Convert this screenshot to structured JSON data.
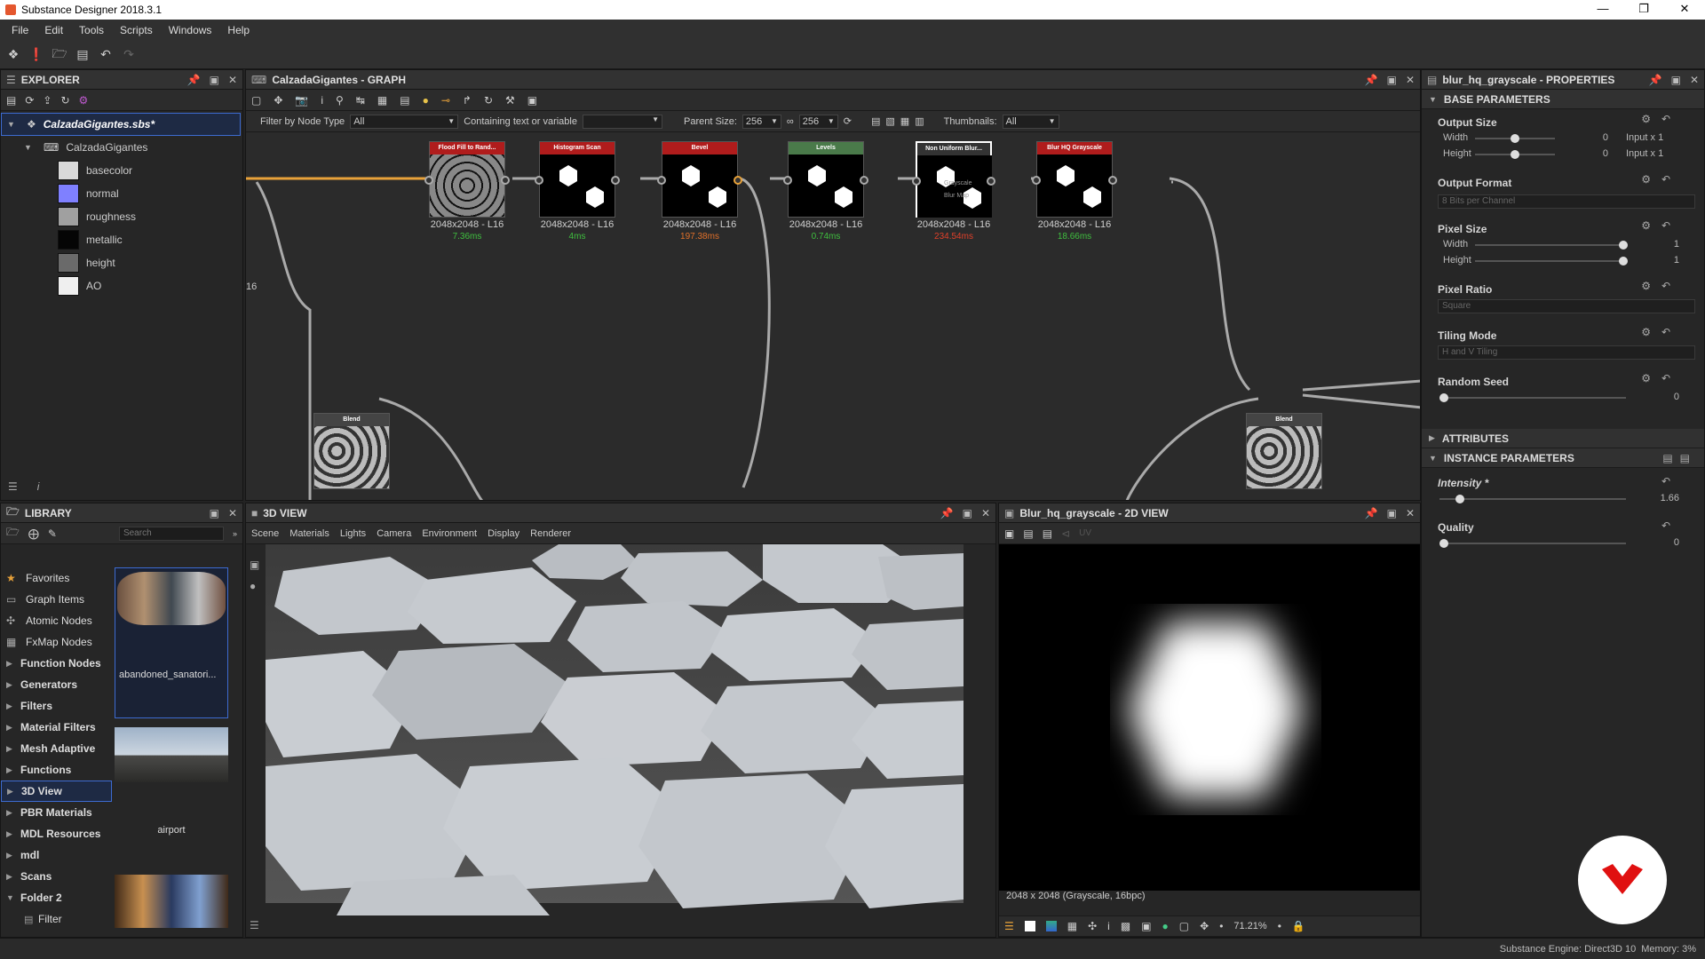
{
  "window": {
    "title": "Substance Designer 2018.3.1"
  },
  "menu": [
    "File",
    "Edit",
    "Tools",
    "Scripts",
    "Windows",
    "Help"
  ],
  "explorer": {
    "title": "EXPLORER",
    "package": "CalzadaGigantes.sbs*",
    "graph": "CalzadaGigantes",
    "outputs": [
      {
        "label": "basecolor",
        "color": "#d9d9d9"
      },
      {
        "label": "normal",
        "color": "#7f80ff"
      },
      {
        "label": "roughness",
        "color": "#a0a0a0"
      },
      {
        "label": "metallic",
        "color": "#050505"
      },
      {
        "label": "height",
        "color": "#6a6a6a"
      },
      {
        "label": "AO",
        "color": "#efefef"
      }
    ]
  },
  "graph": {
    "title": "CalzadaGigantes - GRAPH",
    "filter_label": "Filter by Node Type",
    "filter_value": "All",
    "containing_label": "Containing text or variable",
    "parent_size_label": "Parent Size:",
    "parent_size_1": "256",
    "parent_size_2": "256",
    "thumbnails_label": "Thumbnails:",
    "thumbnails_value": "All",
    "left_edge_label": "16",
    "nodes": [
      {
        "title": "Flood Fill to Rand...",
        "color": "#b01c1c",
        "label": "2048x2048 - L16",
        "time": "7.36ms",
        "time_color": "#3fbf3f"
      },
      {
        "title": "Histogram Scan",
        "color": "#b01c1c",
        "label": "2048x2048 - L16",
        "time": "4ms",
        "time_color": "#3fbf3f"
      },
      {
        "title": "Bevel",
        "color": "#b01c1c",
        "label": "2048x2048 - L16",
        "time": "197.38ms",
        "time_color": "#e0702a"
      },
      {
        "title": "Levels",
        "color": "#4a7a4a",
        "label": "2048x2048 - L16",
        "time": "0.74ms",
        "time_color": "#3fbf3f"
      },
      {
        "title": "Non Uniform Blur...",
        "color": "#333333",
        "label": "2048x2048 - L16",
        "time": "234.54ms",
        "time_color": "#e0402a"
      },
      {
        "title": "Blur HQ Grayscale",
        "color": "#b01c1c",
        "label": "2048x2048 - L16",
        "time": "18.66ms",
        "time_color": "#3fbf3f"
      }
    ],
    "blend_left_title": "Blend",
    "blend_right_title": "Blend",
    "port_text_1": "Grayscale",
    "port_text_2": "Blur Map"
  },
  "library": {
    "title": "LIBRARY",
    "search_placeholder": "Search",
    "categories": [
      {
        "label": "Favorites",
        "icon": "star-icon",
        "bold": false
      },
      {
        "label": "Graph Items",
        "icon": "graph-icon",
        "bold": false
      },
      {
        "label": "Atomic Nodes",
        "icon": "atom-icon",
        "bold": false
      },
      {
        "label": "FxMap Nodes",
        "icon": "grid-icon",
        "bold": false
      },
      {
        "label": "Function Nodes",
        "bold": true
      },
      {
        "label": "Generators",
        "bold": true
      },
      {
        "label": "Filters",
        "bold": true
      },
      {
        "label": "Material Filters",
        "bold": true
      },
      {
        "label": "Mesh Adaptive",
        "bold": true
      },
      {
        "label": "Functions",
        "bold": true
      },
      {
        "label": "3D View",
        "bold": true
      },
      {
        "label": "PBR Materials",
        "bold": true
      },
      {
        "label": "MDL Resources",
        "bold": true
      },
      {
        "label": "mdl",
        "bold": true
      },
      {
        "label": "Scans",
        "bold": true
      },
      {
        "label": "Folder 2",
        "bold": true
      },
      {
        "label": "Filter",
        "bold": false
      }
    ],
    "thumbs": [
      "abandoned_sanatori...",
      "airport"
    ]
  },
  "view3d": {
    "title": "3D VIEW",
    "menu": [
      "Scene",
      "Materials",
      "Lights",
      "Camera",
      "Environment",
      "Display",
      "Renderer"
    ]
  },
  "view2d": {
    "title": "Blur_hq_grayscale - 2D VIEW",
    "uv_label": "UV",
    "info": "2048 x 2048 (Grayscale, 16bpc)",
    "zoom": "71.21%"
  },
  "properties": {
    "title": "blur_hq_grayscale - PROPERTIES",
    "base_params": "BASE PARAMETERS",
    "output_size": "Output Size",
    "width_label": "Width",
    "height_label": "Height",
    "out_w_val": "0",
    "out_h_val": "0",
    "out_w_rel": "Input x 1",
    "out_h_rel": "Input x 1",
    "output_format": "Output Format",
    "output_format_val": "8 Bits per Channel",
    "pixel_size": "Pixel Size",
    "px_w_val": "1",
    "px_h_val": "1",
    "pixel_ratio": "Pixel Ratio",
    "pixel_ratio_val": "Square",
    "tiling_mode": "Tiling Mode",
    "tiling_mode_val": "H and V Tiling",
    "random_seed": "Random Seed",
    "random_seed_val": "0",
    "attributes": "ATTRIBUTES",
    "instance_params": "INSTANCE PARAMETERS",
    "intensity": "Intensity *",
    "intensity_val": "1.66",
    "quality": "Quality",
    "quality_val": "0"
  },
  "status": {
    "engine": "Substance Engine: Direct3D 10",
    "memory": "Memory: 3%"
  }
}
